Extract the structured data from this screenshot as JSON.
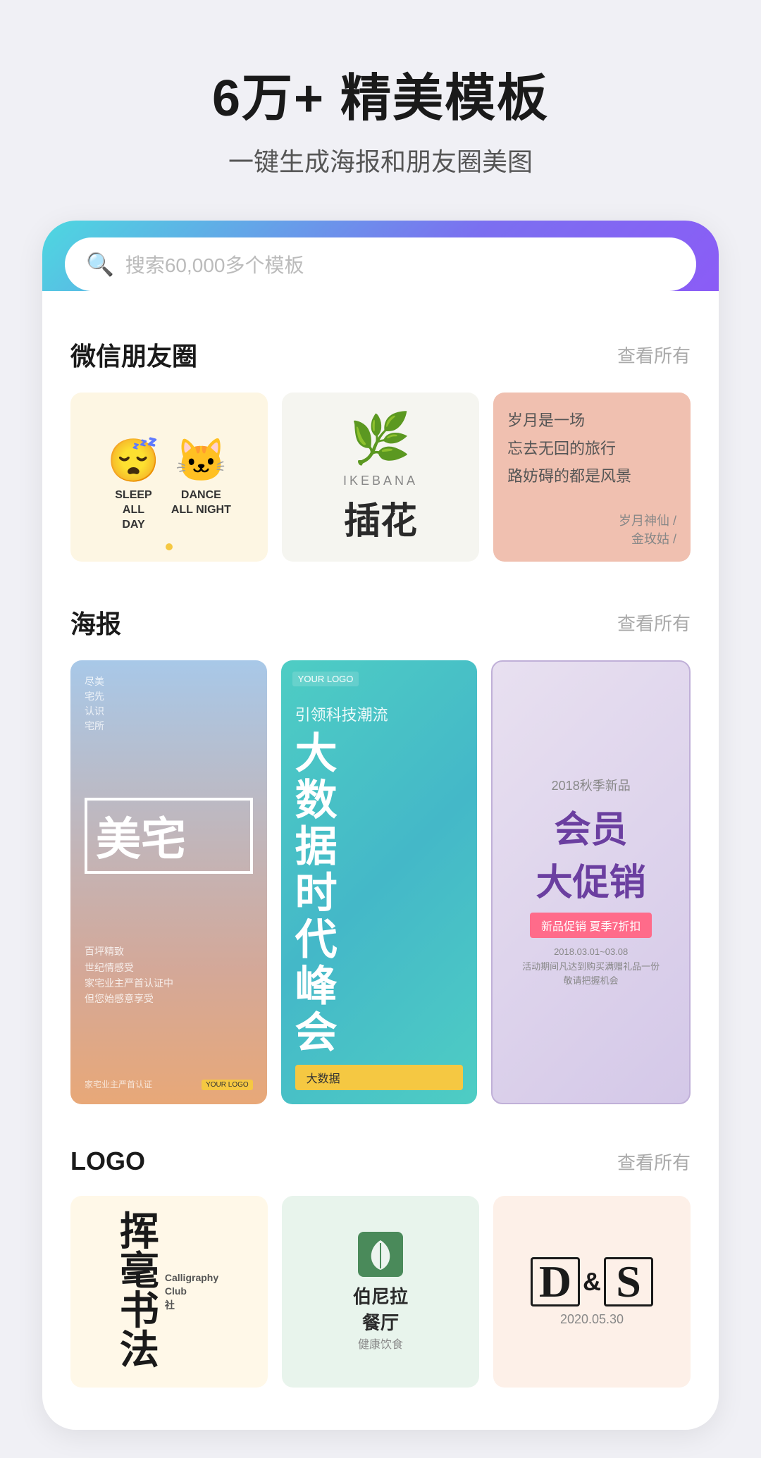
{
  "header": {
    "title": "6万+ 精美模板",
    "subtitle": "一键生成海报和朋友圈美图"
  },
  "search": {
    "placeholder": "搜索60,000多个模板"
  },
  "sections": [
    {
      "id": "wechat",
      "title": "微信朋友圈",
      "more": "查看所有",
      "cards": [
        {
          "id": "wc1",
          "type": "sleep-dance",
          "char1_label": "SLEEP\nALL\nDAY",
          "char2_label": "DANCE\nALL NIGHT"
        },
        {
          "id": "wc2",
          "type": "ikebana",
          "en": "IKEBANA",
          "cn": "插花"
        },
        {
          "id": "wc3",
          "type": "poem",
          "lines": [
            "岁月是一场",
            "忘去无回的旅行",
            "路上妨碍的都是风景"
          ],
          "author": "岁月神仙 /\n金玫姑 /"
        }
      ]
    },
    {
      "id": "poster",
      "title": "海报",
      "more": "查看所有",
      "cards": [
        {
          "id": "p1",
          "type": "real-estate",
          "main": "美宅",
          "tagline": "尽美宅先认识宅所",
          "details": "百坪精致\n世纪情感受\n家宅业主严首认证中\n但您始感意享受",
          "logo": "YOUR LOGO"
        },
        {
          "id": "p2",
          "type": "tech-summit",
          "your_logo": "YOUR LOGO",
          "subtitle": "引领科技潮流",
          "title": "大\n数\n据\n时\n代\n峰\n会",
          "badge": "大数据"
        },
        {
          "id": "p3",
          "type": "member-promo",
          "year": "2018秋季新品",
          "main": "会员\n大促销",
          "sub": "新品促销 夏季7折扣",
          "details": "2018.03.01~03.08\n活动期间凡达到购买满赠礼品一份\n敬请把握机会"
        }
      ]
    },
    {
      "id": "logo",
      "title": "LOGO",
      "more": "查看所有",
      "cards": [
        {
          "id": "l1",
          "type": "calligraphy",
          "cn_chars": "挥毫\n书法",
          "en": "Calligraphy\nClub\n社"
        },
        {
          "id": "l2",
          "type": "restaurant",
          "name": "伯尼拉\n餐厅",
          "sub": "健康饮食"
        },
        {
          "id": "l3",
          "type": "ds-brand",
          "logo": "D&S",
          "date": "2020.05.30"
        }
      ]
    }
  ]
}
